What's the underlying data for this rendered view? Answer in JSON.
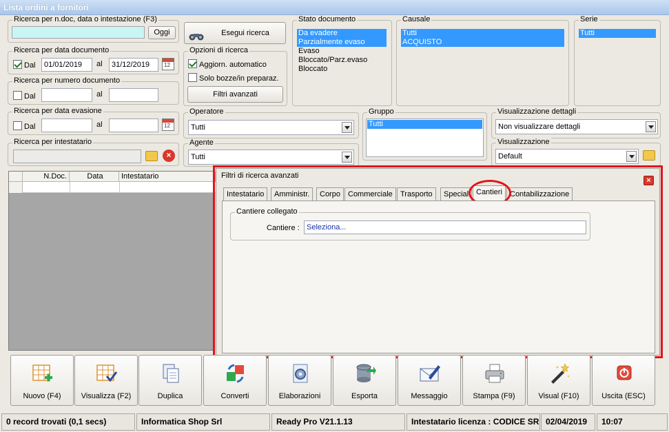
{
  "window": {
    "title": "Lista ordini a fornitori"
  },
  "search_ndoc": {
    "label": "Ricerca per n.doc, data o intestazione (F3)",
    "value": "",
    "today_label": "Oggi"
  },
  "run_search": {
    "label": "Esegui ricerca"
  },
  "date_doc": {
    "label": "Ricerca per data documento",
    "dal_label": "Dal",
    "al_label": "al",
    "from": "01/01/2019",
    "to": "31/12/2019"
  },
  "num_doc": {
    "label": "Ricerca per numero documento",
    "dal_label": "Dal",
    "al_label": "al",
    "from": "",
    "to": ""
  },
  "options": {
    "label": "Opzioni di ricerca",
    "auto_update": "Aggiorn. automatico",
    "drafts": "Solo bozze/in preparaz.",
    "advanced": "Filtri avanzati"
  },
  "stato": {
    "label": "Stato documento",
    "items": [
      "Da evadere",
      "Parzialmente evaso",
      "Evaso",
      "Bloccato/Parz.evaso",
      "Bloccato"
    ]
  },
  "causale": {
    "label": "Causale",
    "items": [
      "Tutti",
      "ACQUISTO"
    ]
  },
  "serie": {
    "label": "Serie",
    "items": [
      "Tutti"
    ]
  },
  "date_ev": {
    "label": "Ricerca per data evasione",
    "dal_label": "Dal",
    "al_label": "al",
    "from": "",
    "to": ""
  },
  "operatore": {
    "label": "Operatore",
    "value": "Tutti"
  },
  "gruppo": {
    "label": "Gruppo",
    "items": [
      "Tutti"
    ]
  },
  "vis_dettagli": {
    "label": "Visualizzazione dettagli",
    "value": "Non visualizzare dettagli"
  },
  "intestatario": {
    "label": "Ricerca per intestatario",
    "value": ""
  },
  "agente": {
    "label": "Agente",
    "value": "Tutti"
  },
  "visualizzazione": {
    "label": "Visualizzazione",
    "value": "Default"
  },
  "grid": {
    "columns": [
      "N.Doc.",
      "Data",
      "Intestatario"
    ]
  },
  "advanced_panel": {
    "title": "Filtri di ricerca avanzati",
    "tabs": [
      "Intestatario",
      "Amministr.",
      "Corpo",
      "Commerciale",
      "Trasporto",
      "Special",
      "Cantieri",
      "Contabilizzazione"
    ],
    "active_tab": "Cantieri",
    "cantiere_group": "Cantiere collegato",
    "cantiere_label": "Cantiere :",
    "cantiere_value": "Seleziona..."
  },
  "buttons": {
    "nuovo": "Nuovo (F4)",
    "visualizza": "Visualizza (F2)",
    "duplica": "Duplica",
    "converti": "Converti",
    "elaborazioni": "Elaborazioni",
    "esporta": "Esporta",
    "messaggio": "Messaggio",
    "stampa": "Stampa (F9)",
    "visual": "Visual (F10)",
    "uscita": "Uscita (ESC)"
  },
  "status": {
    "records": "0 record trovati (0,1 secs)",
    "company": "Informatica Shop Srl",
    "version": "Ready Pro V21.1.13",
    "license": "Intestatario licenza : CODICE SRL",
    "date": "02/04/2019",
    "time": "10:07"
  }
}
